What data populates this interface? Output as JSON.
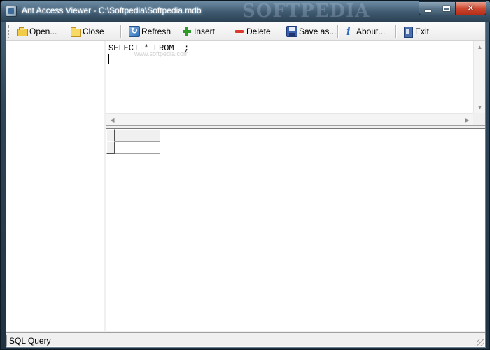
{
  "window": {
    "title": "Ant Access Viewer - C:\\Softpedia\\Softpedia.mdb",
    "watermark": "SOFTPEDIA"
  },
  "toolbar": {
    "buttons": [
      {
        "label": "Open...",
        "icon": "open-folder-icon"
      },
      {
        "label": "Close",
        "icon": "folder-icon"
      },
      {
        "label": "Refresh",
        "icon": "refresh-icon"
      },
      {
        "label": "Insert",
        "icon": "plus-icon"
      },
      {
        "label": "Delete",
        "icon": "minus-icon"
      },
      {
        "label": "Save as...",
        "icon": "floppy-disk-icon"
      },
      {
        "label": "About...",
        "icon": "info-icon"
      },
      {
        "label": "Exit",
        "icon": "exit-door-icon"
      }
    ]
  },
  "editor": {
    "sql_text": "SELECT * FROM  ;",
    "watermark": "www.softpedia.com"
  },
  "statusbar": {
    "text": "SQL Query"
  },
  "colors": {
    "titlebar": "#3f5a70",
    "client": "#f0f0f0",
    "close_button": "#cf4a32"
  }
}
